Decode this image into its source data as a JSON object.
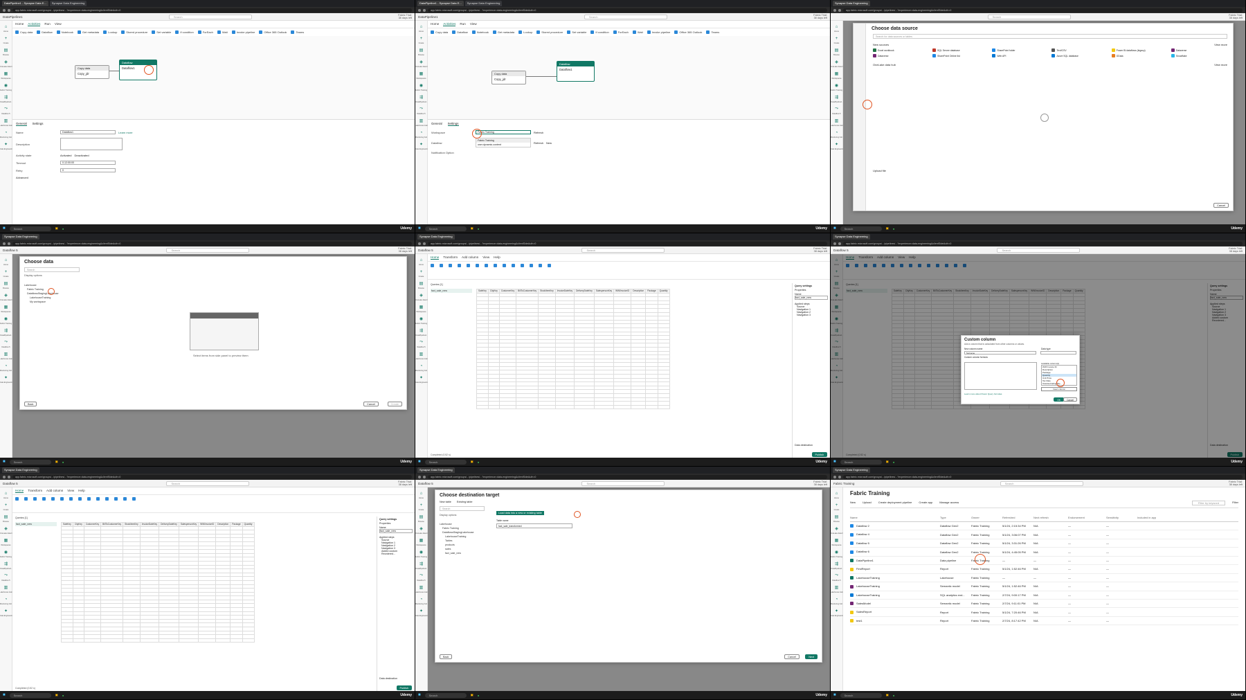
{
  "colors": {
    "fabric_green": "#117865",
    "highlight_circle": "#e0521f",
    "primary_blue": "#2b88d8"
  },
  "browser": {
    "tab_pipeline": "DataPipeline1 - Synapse Data E...",
    "tab_synapse": "Synapse Data Engineering",
    "url": "app.fabric.microsoft.com/groups/.../pipelines/...?experience=data-engineering&clientSideAuth=0"
  },
  "appbar": {
    "search": "Search",
    "trial": "Fabric Trial:",
    "days": "38 days left"
  },
  "nav": [
    "Home",
    "Create",
    "Browse",
    "OneLake data hub",
    "Workspaces",
    "Fabric Training",
    "DataPipeline1",
    "Dataflow 5",
    "Lakehouse training",
    "Monitoring hub",
    "Data Engineering"
  ],
  "taskbar": {
    "search": "Search",
    "brand": "Udemy"
  },
  "pipeline": {
    "title": "DataPipeline1",
    "menu": [
      "Home",
      "Activities",
      "Run",
      "View"
    ],
    "tools": [
      "Copy data",
      "Dataflow",
      "Notebook",
      "Get metadata",
      "Lookup",
      "Stored procedure",
      "Set variable",
      "If condition",
      "ForEach",
      "Wait",
      "Invoke pipeline",
      "Office 365 Outlook",
      "Teams"
    ],
    "node_copy": "Copy data",
    "node_copy_name": "Copy_jdr",
    "node_dataflow": "Dataflow",
    "node_dataflow_name": "Dataflow1",
    "props_tabs": [
      "General",
      "Settings"
    ],
    "fields": [
      {
        "label": "Name",
        "value": "Dataflow1"
      },
      {
        "label": "Description",
        "value": ""
      },
      {
        "label": "Activity state",
        "value": "Activated"
      },
      {
        "label": "Timeout",
        "value": "0.12:00:00"
      },
      {
        "label": "Retry",
        "value": "0"
      }
    ],
    "learn_more": "Learn more",
    "deactivated": "Deactivated",
    "advanced": "Advanced",
    "settings_fields": [
      {
        "label": "Workspace",
        "value": "Fabric Training"
      },
      {
        "label": "Dataflow",
        "value": ""
      },
      {
        "label": "Notification Option",
        "value": ""
      }
    ],
    "ws_options": [
      "Fabric Training",
      "user.dynamic.content"
    ],
    "refresh": "Refresh",
    "new": "New"
  },
  "choose_source": {
    "title": "Choose data source",
    "search": "Search for data sources or tables",
    "new_sources": "New sources",
    "view_more": "View more",
    "sources": [
      "Excel workbook",
      "SQL Server database",
      "SharePoint folder",
      "Text/CSV",
      "Power BI dataflows (legacy)",
      "Dataverse",
      "Dataverse",
      "SharePoint Online list",
      "Web API",
      "Azure SQL database",
      "OData",
      "Snowflake"
    ],
    "onelake": "OneLake data hub",
    "upload": "Upload file",
    "cancel": "Cancel"
  },
  "choose_data": {
    "title": "Choose data",
    "search": "Search",
    "display": "Display options",
    "tree": [
      "Lakehouse",
      "Fabric Training",
      "DataflowsStagingLakehouse",
      "LakehouseTraining",
      "My workspace"
    ],
    "empty": "Select items from side panel to preview them",
    "back": "Back",
    "cancel": "Cancel",
    "create": "Create"
  },
  "power_query": {
    "title": "Dataflow 5",
    "menu": [
      "Home",
      "Transform",
      "Add column",
      "View",
      "Help"
    ],
    "queries": "Queries [1]",
    "query_name": "fact_sale_new",
    "columns": [
      "SaleKey",
      "CityKey",
      "CustomerKey",
      "BillToCustomerKey",
      "StockItemKey",
      "InvoiceDateKey",
      "DeliveryDateKey",
      "SalespersonKey",
      "WWIInvoiceID",
      "Description",
      "Package",
      "Quantity",
      "UnitPrice",
      "TaxRate"
    ],
    "query_settings": "Query settings",
    "properties": "Properties",
    "name_label": "Name",
    "applied": "Applied steps",
    "steps": [
      "Source",
      "Navigation 1",
      "Navigation 2",
      "Navigation 3",
      "Added custom",
      "Reordered..."
    ],
    "dest": "Data destination",
    "status": "Completed (0.52 s)",
    "publish": "Publish"
  },
  "custom_column": {
    "title": "Custom column",
    "sub": "Add a column that is calculated from other columns or values.",
    "new_name_label": "New column name",
    "new_name": "Surname",
    "type_label": "Data type",
    "formula_label": "Custom column formula",
    "avail": "Available column(s)",
    "avail_cols": [
      "WWI Invoice ID",
      "Description",
      "Package",
      "Quantity",
      "Unit Price",
      "Tax Rate",
      "Total Excluding Tax"
    ],
    "insert": "Insert column",
    "learn": "Learn more about Power Query formulas",
    "ok": "OK",
    "cancel": "Cancel"
  },
  "destination": {
    "title": "Choose destination target",
    "new": "New table",
    "existing": "Existing table",
    "search": "Search",
    "display": "Display options",
    "tree": [
      "Lakehouse",
      "Fabric Training",
      "DataflowsStagingLakehouse",
      "LakehouseTraining",
      "Tables",
      "products",
      "sales",
      "fact_sale_new"
    ],
    "hint": "Load data into a new or existing table",
    "table_label": "Table name",
    "table": "fact_sale_transformed",
    "back": "Back",
    "cancel": "Cancel",
    "next": "Next"
  },
  "workspace": {
    "title": "Fabric Training",
    "toolbar": [
      "New",
      "Upload",
      "Create deployment pipeline",
      "Create app",
      "Manage access"
    ],
    "filter_placeholder": "Filter by keyword",
    "filter": "Filter",
    "headers": [
      "Name",
      "Type",
      "Owner",
      "Refreshed",
      "Next refresh",
      "Endorsement",
      "Sensitivity",
      "Included in app"
    ],
    "rows": [
      {
        "name": "Dataflow 2",
        "type": "Dataflow Gen2",
        "owner": "Fabric Training",
        "refreshed": "5/1/24, 2:15:34 PM",
        "next": "N/A",
        "end": "—",
        "sens": "—"
      },
      {
        "name": "Dataflow 4",
        "type": "Dataflow Gen2",
        "owner": "Fabric Training",
        "refreshed": "5/1/24, 3:06:07 PM",
        "next": "N/A",
        "end": "—",
        "sens": "—"
      },
      {
        "name": "Dataflow 5",
        "type": "Dataflow Gen2",
        "owner": "Fabric Training",
        "refreshed": "5/1/24, 3:31:26 PM",
        "next": "N/A",
        "end": "—",
        "sens": "—"
      },
      {
        "name": "Dataflow 6",
        "type": "Dataflow Gen2",
        "owner": "Fabric Training",
        "refreshed": "5/1/24, 4:45:05 PM",
        "next": "N/A",
        "end": "—",
        "sens": "—"
      },
      {
        "name": "DataPipeline1",
        "type": "Data pipeline",
        "owner": "Fabric Training",
        "refreshed": "—",
        "next": "—",
        "end": "—",
        "sens": "—"
      },
      {
        "name": "FirstReport",
        "type": "Report",
        "owner": "Fabric Training",
        "refreshed": "5/1/24, 1:52:46 PM",
        "next": "N/A",
        "end": "—",
        "sens": "—"
      },
      {
        "name": "LakehouseTraining",
        "type": "Lakehouse",
        "owner": "Fabric Training",
        "refreshed": "—",
        "next": "—",
        "end": "—",
        "sens": "—"
      },
      {
        "name": "LakehouseTraining",
        "type": "Semantic model",
        "owner": "Fabric Training",
        "refreshed": "5/1/24, 1:52:46 PM",
        "next": "N/A",
        "end": "—",
        "sens": "—"
      },
      {
        "name": "LakehouseTraining",
        "type": "SQL analytics end...",
        "owner": "Fabric Training",
        "refreshed": "2/7/24, 9:00:17 PM",
        "next": "N/A",
        "end": "—",
        "sens": "—"
      },
      {
        "name": "SalesModel",
        "type": "Semantic model",
        "owner": "Fabric Training",
        "refreshed": "2/7/24, 9:11:01 PM",
        "next": "N/A",
        "end": "—",
        "sens": "—"
      },
      {
        "name": "SalesReport",
        "type": "Report",
        "owner": "Fabric Training",
        "refreshed": "5/1/24, 7:20:46 PM",
        "next": "N/A",
        "end": "—",
        "sens": "—"
      },
      {
        "name": "test1",
        "type": "Report",
        "owner": "Fabric Training",
        "refreshed": "2/7/24, 8:17:42 PM",
        "next": "N/A",
        "end": "—",
        "sens": "—"
      }
    ]
  }
}
